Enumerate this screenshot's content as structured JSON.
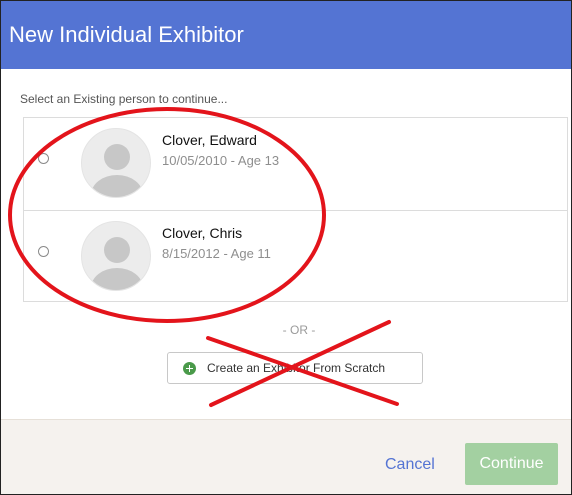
{
  "dialog": {
    "title": "New Individual Exhibitor",
    "instruction": "Select an Existing person to continue..."
  },
  "people": [
    {
      "name": "Clover, Edward",
      "dob": "10/05/2010 - Age 13"
    },
    {
      "name": "Clover, Chris",
      "dob": "8/15/2012 - Age 11"
    }
  ],
  "separator": "- OR -",
  "create_button": {
    "label": "Create an Exhibitor From Scratch",
    "icon": "plus-circle-icon"
  },
  "footer": {
    "cancel_label": "Cancel",
    "continue_label": "Continue"
  },
  "colors": {
    "header": "#5474d3",
    "continue": "#a3d0a1",
    "annotation": "#e3141b"
  }
}
